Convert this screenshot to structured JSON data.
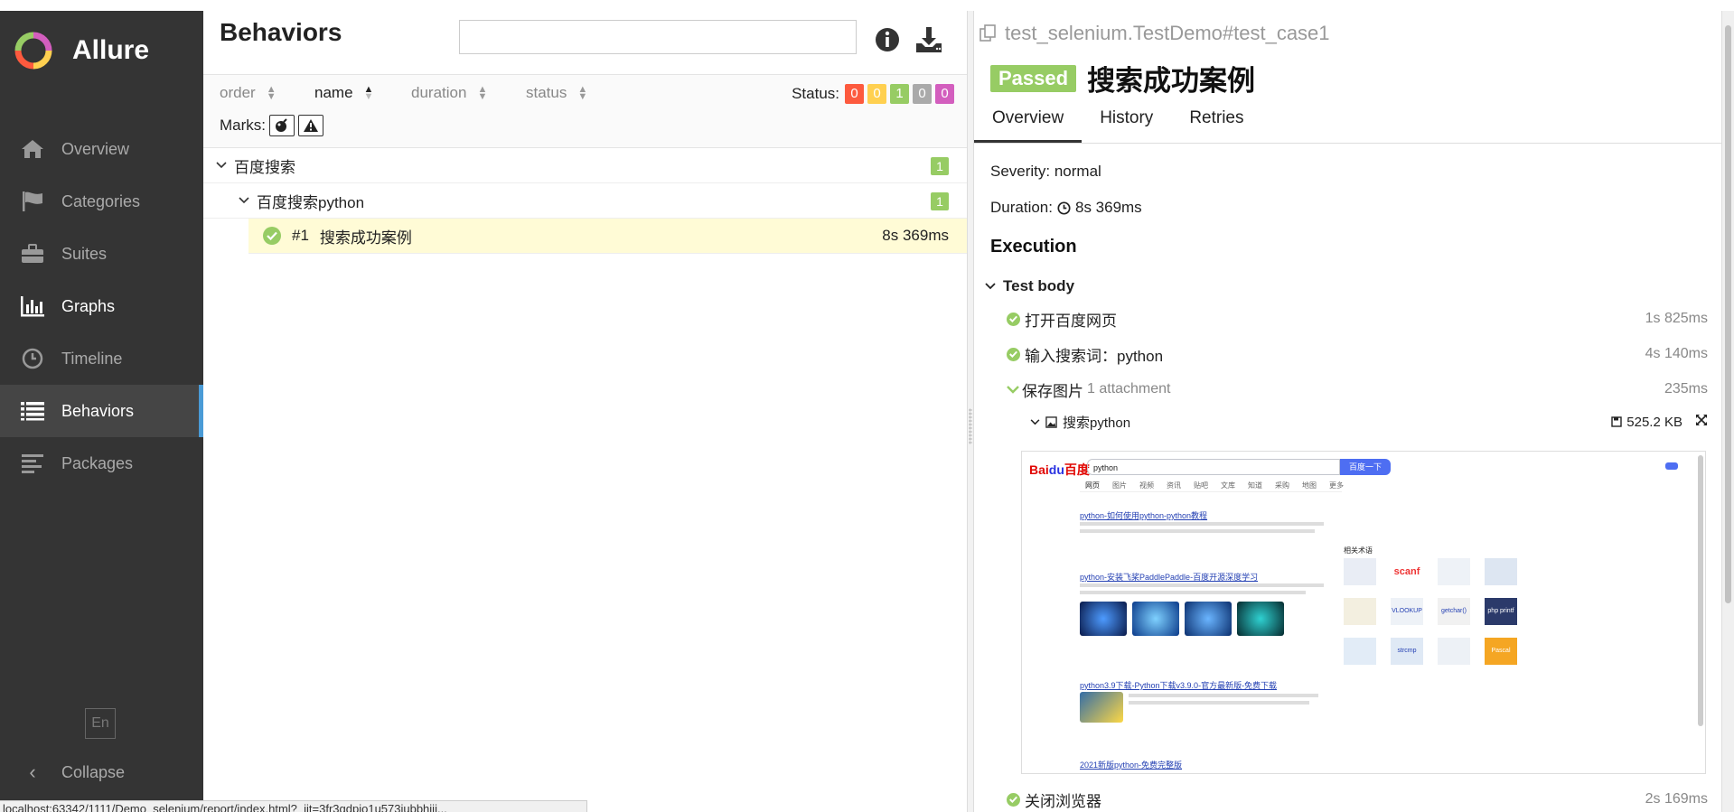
{
  "app": {
    "name": "Allure"
  },
  "sidebar": {
    "items": [
      {
        "label": "Overview",
        "icon": "home-icon"
      },
      {
        "label": "Categories",
        "icon": "flag-icon"
      },
      {
        "label": "Suites",
        "icon": "briefcase-icon"
      },
      {
        "label": "Graphs",
        "icon": "bar-chart-icon"
      },
      {
        "label": "Timeline",
        "icon": "clock-icon"
      },
      {
        "label": "Behaviors",
        "icon": "list-icon"
      },
      {
        "label": "Packages",
        "icon": "align-left-icon"
      }
    ],
    "active": "Behaviors",
    "lang": "En",
    "collapse_label": "Collapse"
  },
  "statusbar": {
    "url": "localhost:63342/1111/Demo_selenium/report/index.html?_ijt=3fr3gdpio1u573iubbhiji..."
  },
  "behaviors": {
    "title": "Behaviors",
    "search_placeholder": "",
    "sort": {
      "order": "order",
      "name": "name",
      "duration": "duration",
      "status": "status"
    },
    "status_label": "Status:",
    "status_counts": [
      {
        "value": "0",
        "color": "#fd5a3e"
      },
      {
        "value": "0",
        "color": "#ffd050"
      },
      {
        "value": "1",
        "color": "#97cc64"
      },
      {
        "value": "0",
        "color": "#aaaaaa"
      },
      {
        "value": "0",
        "color": "#d35ebe"
      }
    ],
    "marks_label": "Marks:",
    "tree": {
      "group": {
        "label": "百度搜索",
        "count": "1"
      },
      "subgroup": {
        "label": "百度搜索python",
        "count": "1"
      },
      "leaf": {
        "index": "#1",
        "label": "搜索成功案例",
        "duration": "8s 369ms"
      }
    }
  },
  "testcase": {
    "crumb": "test_selenium.TestDemo#test_case1",
    "status": "Passed",
    "title": "搜索成功案例",
    "tabs": [
      "Overview",
      "History",
      "Retries"
    ],
    "severity": "Severity: normal",
    "duration_label": "Duration:",
    "duration": "8s 369ms",
    "execution_label": "Execution",
    "test_body_label": "Test body",
    "steps": [
      {
        "label": "打开百度网页",
        "time": "1s 825ms"
      },
      {
        "label": "输入搜索词：python",
        "time": "4s 140ms"
      },
      {
        "label": "保存图片",
        "note": "1 attachment",
        "time": "235ms"
      },
      {
        "label": "关闭浏览器",
        "time": "2s 169ms"
      }
    ],
    "attachment": {
      "name": "搜索python",
      "size": "525.2 KB"
    }
  },
  "screenshot": {
    "search_value": "python",
    "search_button": "百度一下",
    "nav": [
      "网页",
      "图片",
      "视频",
      "资讯",
      "贴吧",
      "文库",
      "知道",
      "采购",
      "地图",
      "更多"
    ],
    "results": [
      "python-如何使用python-python教程",
      "python-安装飞桨PaddlePaddle-百度开源深度学习",
      "python3.9下载-Python下载v3.9.0-官方最新版-免费下载",
      "2021新版python-免费完整版"
    ],
    "right_title": "相关术语",
    "right_items": [
      "scanf",
      "VLOOKUP",
      "getchar()",
      "php printf",
      "strcmp",
      "Pascal"
    ]
  }
}
